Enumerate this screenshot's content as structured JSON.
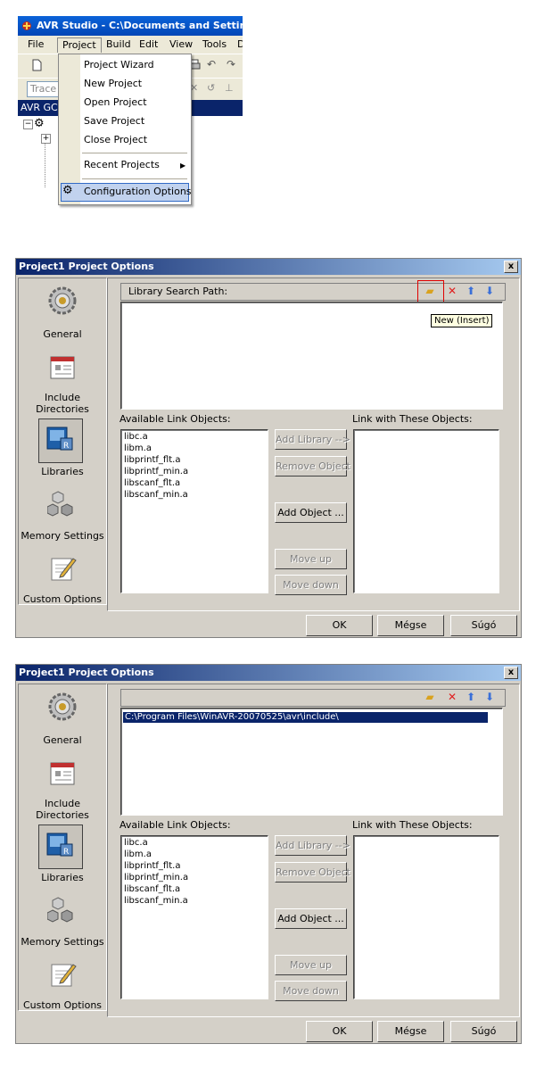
{
  "studio": {
    "title": "AVR Studio - C:\\Documents and Settings\\",
    "menus": [
      "File",
      "Project",
      "Build",
      "Edit",
      "View",
      "Tools",
      "D"
    ],
    "toolbar_combo": "Trace",
    "strip_label": "AVR GC",
    "project_menu": {
      "items": [
        "Project Wizard",
        "New Project",
        "Open Project",
        "Save Project",
        "Close Project",
        "Recent Projects",
        "Configuration Options"
      ]
    }
  },
  "dialog1": {
    "title": "Project1 Project Options",
    "close": "x",
    "sidebar": [
      "General",
      "Include Directories",
      "Libraries",
      "Memory Settings",
      "Custom Options"
    ],
    "search_path_label": "Library Search Path:",
    "tooltip": "New (Insert)",
    "available_label": "Available Link Objects:",
    "link_label": "Link with These Objects:",
    "available_items": [
      "libc.a",
      "libm.a",
      "libprintf_flt.a",
      "libprintf_min.a",
      "libscanf_flt.a",
      "libscanf_min.a"
    ],
    "buttons": [
      "Add Library -->",
      "Remove Object",
      "Add Object ...",
      "Move up",
      "Move down"
    ],
    "ok": "OK",
    "cancel": "Mégse",
    "help": "Súgó"
  },
  "dialog2": {
    "title": "Project1 Project Options",
    "close": "x",
    "sidebar": [
      "General",
      "Include Directories",
      "Libraries",
      "Memory Settings",
      "Custom Options"
    ],
    "path_entry": "C:\\Program Files\\WinAVR-20070525\\avr\\include\\",
    "available_label": "Available Link Objects:",
    "link_label": "Link with These Objects:",
    "available_items": [
      "libc.a",
      "libm.a",
      "libprintf_flt.a",
      "libprintf_min.a",
      "libscanf_flt.a",
      "libscanf_min.a"
    ],
    "buttons": [
      "Add Library -->",
      "Remove Object",
      "Add Object ...",
      "Move up",
      "Move down"
    ],
    "ok": "OK",
    "cancel": "Mégse",
    "help": "Súgó"
  },
  "colors": {
    "xp_title": "#0b62d8",
    "dialog_title": "#0a246a",
    "selection": "#0a246a",
    "menu_highlight": "#c1d2ee",
    "face": "#d4d0c8"
  }
}
